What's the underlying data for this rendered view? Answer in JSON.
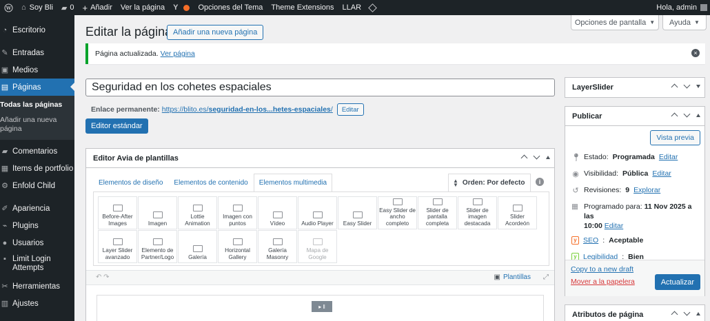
{
  "adminbar": {
    "site_name": "Soy Bli",
    "comments_count": "0",
    "add_new": "Añadir",
    "view_page": "Ver la página",
    "theme_options": "Opciones del Tema",
    "theme_extensions": "Theme Extensions",
    "llar": "LLAR",
    "greeting": "Hola, admin"
  },
  "sidebar": {
    "items": [
      {
        "label": "Escritorio",
        "icon": "dashboard-icon"
      },
      {
        "label": "Entradas",
        "icon": "pin-icon"
      },
      {
        "label": "Medios",
        "icon": "media-icon"
      },
      {
        "label": "Páginas",
        "icon": "pages-icon"
      },
      {
        "label": "Comentarios",
        "icon": "comment-icon"
      },
      {
        "label": "Items de portfolio",
        "icon": "portfolio-icon"
      },
      {
        "label": "Enfold Child",
        "icon": "gear-icon"
      },
      {
        "label": "Apariencia",
        "icon": "brush-icon"
      },
      {
        "label": "Plugins",
        "icon": "plugin-icon"
      },
      {
        "label": "Usuarios",
        "icon": "user-icon"
      },
      {
        "label": "Limit Login Attempts",
        "icon": "lock-icon"
      },
      {
        "label": "Herramientas",
        "icon": "wrench-icon"
      },
      {
        "label": "Ajustes",
        "icon": "settings-icon"
      }
    ],
    "sub": {
      "all": "Todas las páginas",
      "add": "Añadir una nueva página"
    }
  },
  "screen": {
    "options": "Opciones de pantalla",
    "help": "Ayuda"
  },
  "header": {
    "title": "Editar la página",
    "add_new": "Añadir una nueva página"
  },
  "notice": {
    "text": "Página actualizada.",
    "link": "Ver página"
  },
  "post": {
    "title": "Seguridad en los cohetes espaciales",
    "permalink_label": "Enlace permanente:",
    "permalink_prefix": "https://blito.es/",
    "permalink_slug": "seguridad-en-los...hetes-espaciales",
    "permalink_suffix": "/",
    "edit_btn": "Editar",
    "std_editor": "Editor estándar"
  },
  "avia": {
    "title": "Editor Avia de plantillas",
    "tabs": [
      "Elementos de diseño",
      "Elementos de contenido",
      "Elementos multimedia"
    ],
    "sort": "Orden: Por defecto",
    "elements": [
      {
        "label": "Before-After Images",
        "disabled": false
      },
      {
        "label": "Imagen",
        "disabled": false
      },
      {
        "label": "Lottie Animation",
        "disabled": false
      },
      {
        "label": "Imagen con puntos",
        "disabled": false
      },
      {
        "label": "Vídeo",
        "disabled": false
      },
      {
        "label": "Audio Player",
        "disabled": false
      },
      {
        "label": "Easy Slider",
        "disabled": false
      },
      {
        "label": "Easy Slider de ancho completo",
        "disabled": false
      },
      {
        "label": "Slider de pantalla completa",
        "disabled": false
      },
      {
        "label": "Slider de imagen destacada",
        "disabled": false
      },
      {
        "label": "Slider Acordeón",
        "disabled": false
      },
      {
        "label": "Layer Slider avanzado",
        "disabled": false
      },
      {
        "label": "Elemento de Partner/Logo",
        "disabled": false
      },
      {
        "label": "Galería",
        "disabled": false
      },
      {
        "label": "Horizontal Gallery",
        "disabled": false
      },
      {
        "label": "Galería Masonry",
        "disabled": false
      },
      {
        "label": "Mapa de Google",
        "disabled": true
      }
    ],
    "templates": "Plantillas"
  },
  "layerslider": {
    "title": "LayerSlider"
  },
  "publish": {
    "title": "Publicar",
    "preview": "Vista previa",
    "status_label": "Estado:",
    "status_value": "Programada",
    "visibility_label": "Visibilidad:",
    "visibility_value": "Pública",
    "revisions_label": "Revisiones:",
    "revisions_value": "9",
    "explore": "Explorar",
    "scheduled_label": "Programado para:",
    "scheduled_value": "11 Nov 2025 a las",
    "scheduled_time": "10:00",
    "edit": "Editar",
    "seo_label": "SEO",
    "seo_value": "Aceptable",
    "read_label": "Legibilidad",
    "read_value": "Bien",
    "copy_draft": "Copy to a new draft",
    "trash": "Mover a la papelera",
    "update": "Actualizar"
  },
  "attributes": {
    "title": "Atributos de página"
  },
  "colors": {
    "accent": "#2271b1",
    "adminbar": "#1d2327",
    "success": "#00a32a",
    "danger": "#d63638"
  }
}
